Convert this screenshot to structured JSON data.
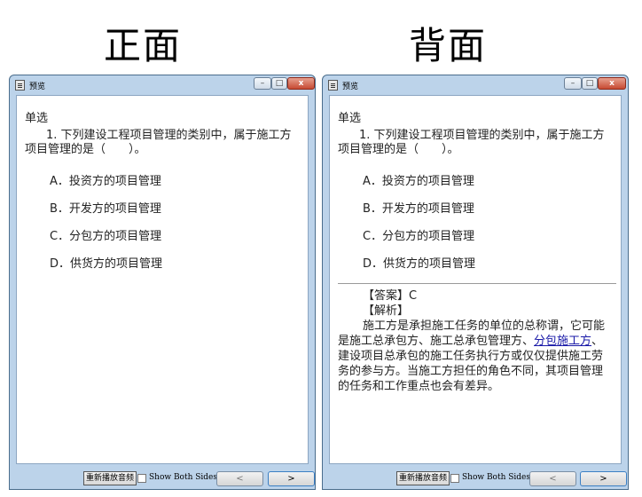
{
  "labels": {
    "front": "正面",
    "back": "背面"
  },
  "window": {
    "title": "预览",
    "minimize": "–",
    "maximize": "□",
    "close": "x"
  },
  "card": {
    "section": "单选",
    "question": "1. 下列建设工程项目管理的类别中，属于施工方项目管理的是（　　）。",
    "options": [
      "A．投资方的项目管理",
      "B．开发方的项目管理",
      "C．分包方的项目管理",
      "D．供货方的项目管理"
    ],
    "answer": "【答案】C",
    "analysis_heading": "【解析】",
    "explanation_before": "施工方是承担施工任务的单位的总称谓，它可能是施工总承包方、施工总承包管理方、",
    "explanation_link": "分包施工方",
    "explanation_after": "、建设项目总承包的施工任务执行方或仅仅提供施工劳务的参与方。当施工方担任的角色不同，其项目管理的任务和工作重点也会有差异。"
  },
  "footer": {
    "replay": "重新播放音频",
    "show_both": "Show Both Sides",
    "prev": "<",
    "next": ">"
  }
}
